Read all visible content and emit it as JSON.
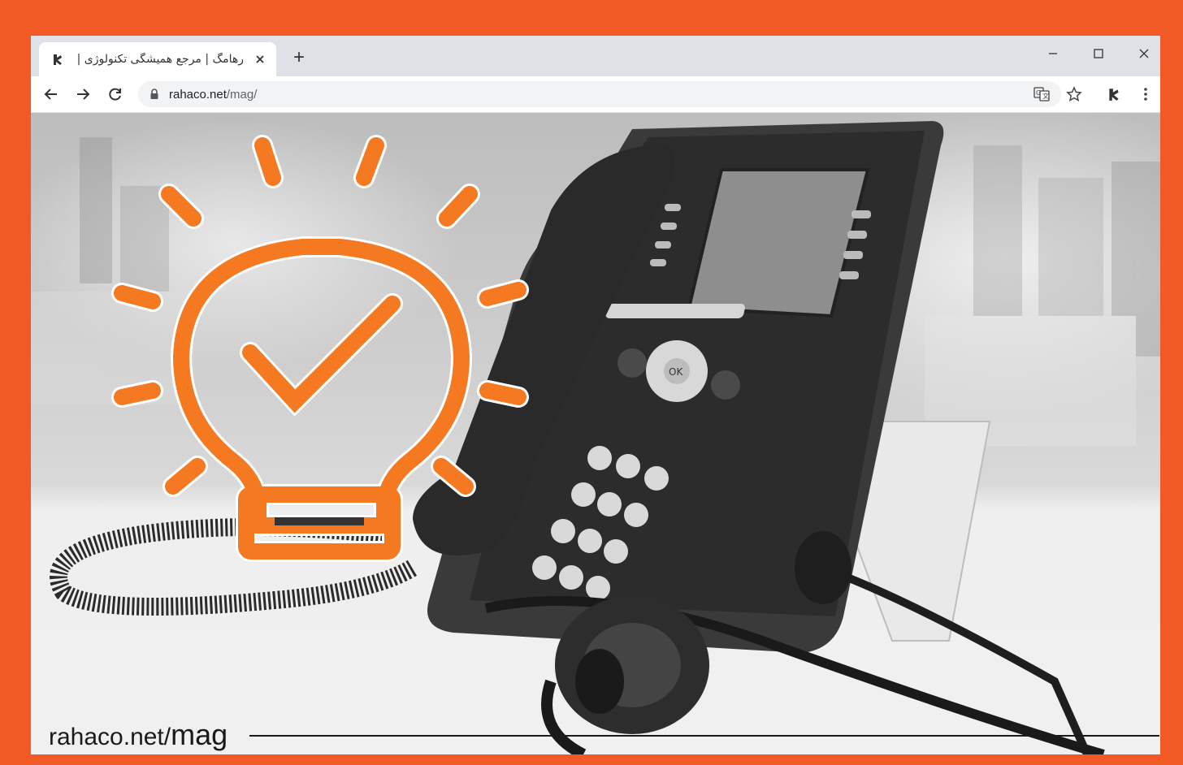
{
  "browser": {
    "tab": {
      "title": "رهامگ | مرجع همیشگی تکنولوژی |",
      "favicon": "rahaco-logo-icon"
    },
    "new_tab_label": "+",
    "window_controls": [
      "minimize-icon",
      "maximize-icon",
      "close-icon"
    ],
    "address_bar": {
      "domain": "rahaco.net",
      "path": "/mag/"
    },
    "toolbar_icons": [
      "back-icon",
      "forward-icon",
      "reload-icon",
      "lock-icon",
      "translate-icon",
      "star-icon",
      "extension-icon",
      "menu-icon"
    ]
  },
  "hero": {
    "description_icons": [
      "lightbulb-check-icon",
      "desk-phone",
      "headset"
    ]
  },
  "footer": {
    "site": "rahaco.net/",
    "site_strong": "mag"
  },
  "colors": {
    "frame": "#f15a24",
    "accent_orange": "#f47920",
    "tab_strip": "#dee1e6",
    "omnibox": "#f1f3f4"
  }
}
